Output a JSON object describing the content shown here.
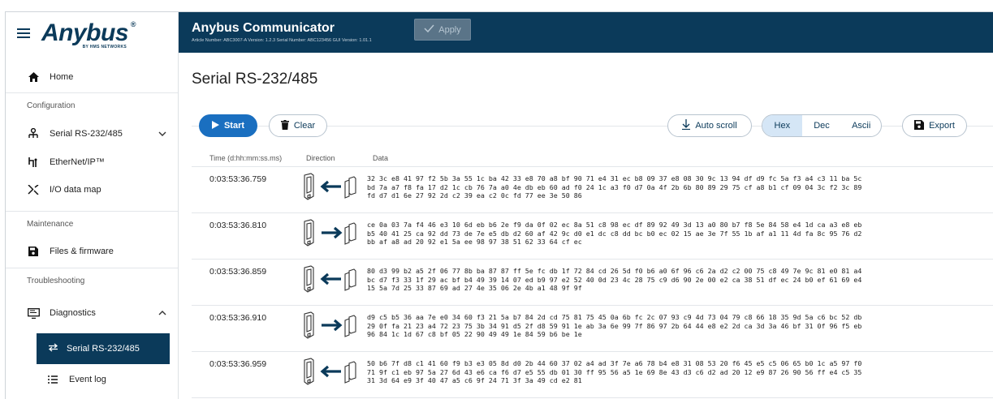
{
  "sidebar": {
    "logo_text": "Anybus",
    "logo_sub": "BY HMS NETWORKS",
    "home": "Home",
    "sections": {
      "configuration": "Configuration",
      "maintenance": "Maintenance",
      "troubleshooting": "Troubleshooting"
    },
    "items": {
      "serial": "Serial RS-232/485",
      "ethernet": "EtherNet/IP™",
      "io_map": "I/O data map",
      "files": "Files & firmware",
      "diagnostics": "Diagnostics",
      "diag_serial": "Serial RS-232/485",
      "event_log": "Event log"
    }
  },
  "header": {
    "title": "Anybus Communicator",
    "meta": "Article Number: ABC3007-A Version: 1.2.3 Serial Number: ABC123456 GUI Version: 1.01.1",
    "apply": "Apply"
  },
  "main": {
    "title": "Serial RS-232/485",
    "toolbar": {
      "start": "Start",
      "clear": "Clear",
      "auto_scroll": "Auto scroll",
      "hex": "Hex",
      "dec": "Dec",
      "ascii": "Ascii",
      "export": "Export",
      "selected_format": "Hex"
    },
    "columns": {
      "time": "Time (d:hh:mm:ss.ms)",
      "direction": "Direction",
      "data": "Data"
    },
    "rows": [
      {
        "time": "0:03:53:36.759",
        "direction": "in",
        "data": "32 3c e8 41 97 f2 5b 3a 55 1c ba 42 33 e8 70 a8 bf 90 71 e4 31 ec b8 09 37 e8 08 30 9c 13 94 df d9 fc 5a f3 a4 c3 11 ba 5c\nbd 7a a7 f8 fa 17 d2 1c cb 76 7a a0 4e db eb 60 ad f0 24 1c a3 f0 d7 0a 4f 2b 6b 80 89 29 75 cf a8 b1 cf 09 04 3c f2 3c 89\nfd d7 d1 6e 27 92 2d c2 39 ea c2 0c fd 77 ee 3e 50 86"
      },
      {
        "time": "0:03:53:36.810",
        "direction": "out",
        "data": "ce 0a 03 7a f4 46 e3 10 6d eb b6 2e f9 da 0f 02 ec 8a 51 c8 98 ec df 89 92 49 3d 13 a0 80 b7 f8 5e 84 58 e4 1d ca a3 e8 eb\nb5 40 41 25 ca 92 dd 73 de 7e e5 db d2 60 af 42 9c d0 e1 dc c8 dd bc b0 ec 02 15 ae 3e 7f 55 1b af a1 11 4d fa 8c 95 76 d2\nbb af a8 ad 20 92 e1 5a ee 98 97 38 51 62 33 64 cf ec"
      },
      {
        "time": "0:03:53:36.859",
        "direction": "in",
        "data": "80 d3 99 b2 a5 2f 06 77 8b ba 87 87 ff 5e fc db 1f 72 84 cd 26 5d f0 b6 a0 6f 96 c6 2a d2 c2 00 75 c8 49 7e 9c 81 e0 81 a4\nbc d7 f3 33 1f 29 ac bf b4 49 39 14 07 ed b9 97 e2 52 40 0d 23 4c 28 75 c9 d6 90 2e 00 e2 ca 38 51 df ec 24 b0 ef 61 69 e4\n15 5a 7d 25 33 87 69 ad 27 4e 35 06 2e 4b a1 48 9f 9f"
      },
      {
        "time": "0:03:53:36.910",
        "direction": "out",
        "data": "d9 c5 b5 36 aa 7e e0 34 60 f3 21 5a b7 84 2d cd 75 81 75 45 0a 6b fc 2c 07 93 c9 4d 73 04 79 c8 66 18 35 9d 5a c6 bc 52 db\n29 0f fa 21 23 a4 72 23 75 3b 34 91 d5 2f d8 59 91 1e ab 3a 6e 99 7f 86 97 2b 64 44 e8 e2 2d ca 3d 3a 46 bf 31 0f 96 f5 eb\n96 84 1c 1d 67 c8 bf 05 22 90 49 49 1e 84 59 b6 be 1e"
      },
      {
        "time": "0:03:53:36.959",
        "direction": "in",
        "data": "50 b6 7f d8 c1 41 60 f9 b3 e3 05 8d d0 2b 44 60 37 02 a4 ad 3f 7e a6 78 b4 e8 31 08 53 20 f6 45 e5 c5 06 65 b0 1c a5 97 f0\n71 9f c1 eb 97 5a 27 6d 43 e6 ca f6 d7 e5 55 db 01 30 ff 95 56 a5 1e 69 8e 43 d3 c6 d2 ad 20 12 e9 87 26 90 56 ff e4 c5 35\n31 3d 64 e9 3f 40 47 a5 c6 9f 24 71 3f 3a 49 cd e2 81"
      }
    ]
  },
  "colors": {
    "brand": "#0b3a5a",
    "primary": "#1a6fc0",
    "selected_segment": "#d5e6f6"
  }
}
